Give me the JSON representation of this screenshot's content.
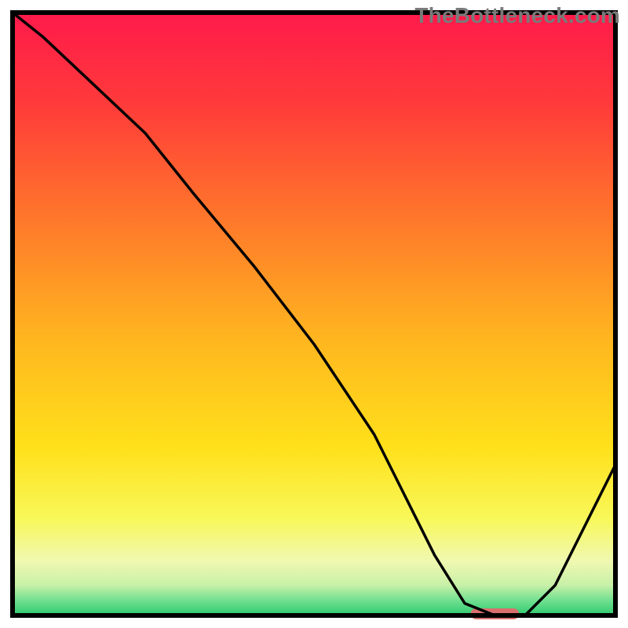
{
  "watermark": "TheBottleneck.com",
  "chart_data": {
    "type": "line",
    "title": "",
    "xlabel": "",
    "ylabel": "",
    "xlim": [
      0,
      100
    ],
    "ylim": [
      0,
      100
    ],
    "x": [
      0,
      5,
      22,
      30,
      40,
      50,
      60,
      70,
      75,
      80,
      85,
      90,
      100
    ],
    "values": [
      100,
      96,
      80,
      70,
      58,
      45,
      30,
      10,
      2,
      0,
      0,
      5,
      25
    ],
    "marker": {
      "x_start": 76,
      "x_end": 84,
      "y": 0,
      "color": "#d9706f"
    },
    "gradient": {
      "stops": [
        {
          "offset": 0.0,
          "color": "#ff1a4b"
        },
        {
          "offset": 0.15,
          "color": "#ff3a3a"
        },
        {
          "offset": 0.35,
          "color": "#ff7a2a"
        },
        {
          "offset": 0.55,
          "color": "#ffb81f"
        },
        {
          "offset": 0.72,
          "color": "#ffe01a"
        },
        {
          "offset": 0.84,
          "color": "#f8f85a"
        },
        {
          "offset": 0.91,
          "color": "#f0f8b0"
        },
        {
          "offset": 0.95,
          "color": "#c8f0a8"
        },
        {
          "offset": 0.975,
          "color": "#70e090"
        },
        {
          "offset": 1.0,
          "color": "#2fc96f"
        }
      ]
    },
    "frame_color": "#000000",
    "frame_width": 6,
    "line_color": "#000000",
    "line_width": 3.5
  }
}
